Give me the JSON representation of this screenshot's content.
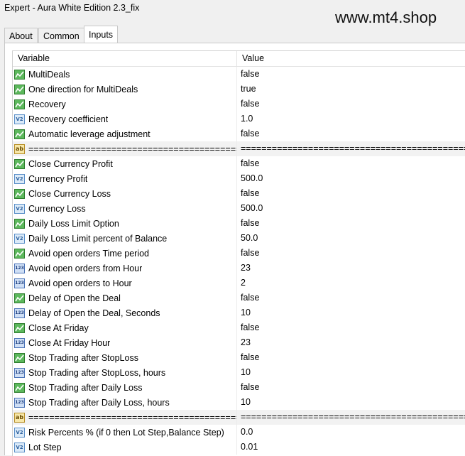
{
  "window": {
    "title": "Expert - Aura White Edition 2.3_fix"
  },
  "watermark": "www.mt4.shop",
  "tabs": [
    {
      "label": "About",
      "active": false
    },
    {
      "label": "Common",
      "active": false
    },
    {
      "label": "Inputs",
      "active": true
    }
  ],
  "table": {
    "headers": {
      "variable": "Variable",
      "value": "Value"
    },
    "rows": [
      {
        "type": "bool",
        "variable": "MultiDeals",
        "value": "false"
      },
      {
        "type": "bool",
        "variable": "One direction for MultiDeals",
        "value": "true"
      },
      {
        "type": "bool",
        "variable": "Recovery",
        "value": "false"
      },
      {
        "type": "double",
        "variable": "Recovery coefficient",
        "value": "1.0"
      },
      {
        "type": "bool",
        "variable": "Automatic leverage adjustment",
        "value": "false"
      },
      {
        "type": "string",
        "variable": "==================================================",
        "value": "=================================================="
      },
      {
        "type": "bool",
        "variable": "Close Currency Profit",
        "value": "false"
      },
      {
        "type": "double",
        "variable": "Currency Profit",
        "value": "500.0"
      },
      {
        "type": "bool",
        "variable": "Close Currency Loss",
        "value": "false"
      },
      {
        "type": "double",
        "variable": "Currency Loss",
        "value": "500.0"
      },
      {
        "type": "bool",
        "variable": "Daily Loss Limit Option",
        "value": "false"
      },
      {
        "type": "double",
        "variable": "Daily Loss Limit percent of Balance",
        "value": "50.0"
      },
      {
        "type": "bool",
        "variable": "Avoid open orders Time period",
        "value": "false"
      },
      {
        "type": "int",
        "variable": "Avoid open orders from Hour",
        "value": "23"
      },
      {
        "type": "int",
        "variable": "Avoid open orders to Hour",
        "value": "2"
      },
      {
        "type": "bool",
        "variable": "Delay of Open the Deal",
        "value": "false"
      },
      {
        "type": "int",
        "variable": "Delay of Open the Deal, Seconds",
        "value": "10"
      },
      {
        "type": "bool",
        "variable": "Close At Friday",
        "value": "false"
      },
      {
        "type": "int",
        "variable": "Close At Friday Hour",
        "value": "23"
      },
      {
        "type": "bool",
        "variable": "Stop Trading after StopLoss",
        "value": "false"
      },
      {
        "type": "int",
        "variable": "Stop Trading after StopLoss, hours",
        "value": "10"
      },
      {
        "type": "bool",
        "variable": "Stop Trading after Daily Loss",
        "value": "false"
      },
      {
        "type": "int",
        "variable": "Stop Trading after Daily Loss, hours",
        "value": "10"
      },
      {
        "type": "string",
        "variable": "==================================================",
        "value": "=================================================="
      },
      {
        "type": "double",
        "variable": "Risk Percents % (if 0 then Lot Step,Balance Step)",
        "value": "0.0"
      },
      {
        "type": "double",
        "variable": "Lot Step",
        "value": "0.01"
      }
    ]
  },
  "icons": {
    "bool": "bool-chart-icon",
    "double": "double-v2-icon",
    "int": "int-123-icon",
    "string": "string-ab-icon"
  },
  "icon_text": {
    "double": "V2",
    "int": "123",
    "string": "ab"
  }
}
